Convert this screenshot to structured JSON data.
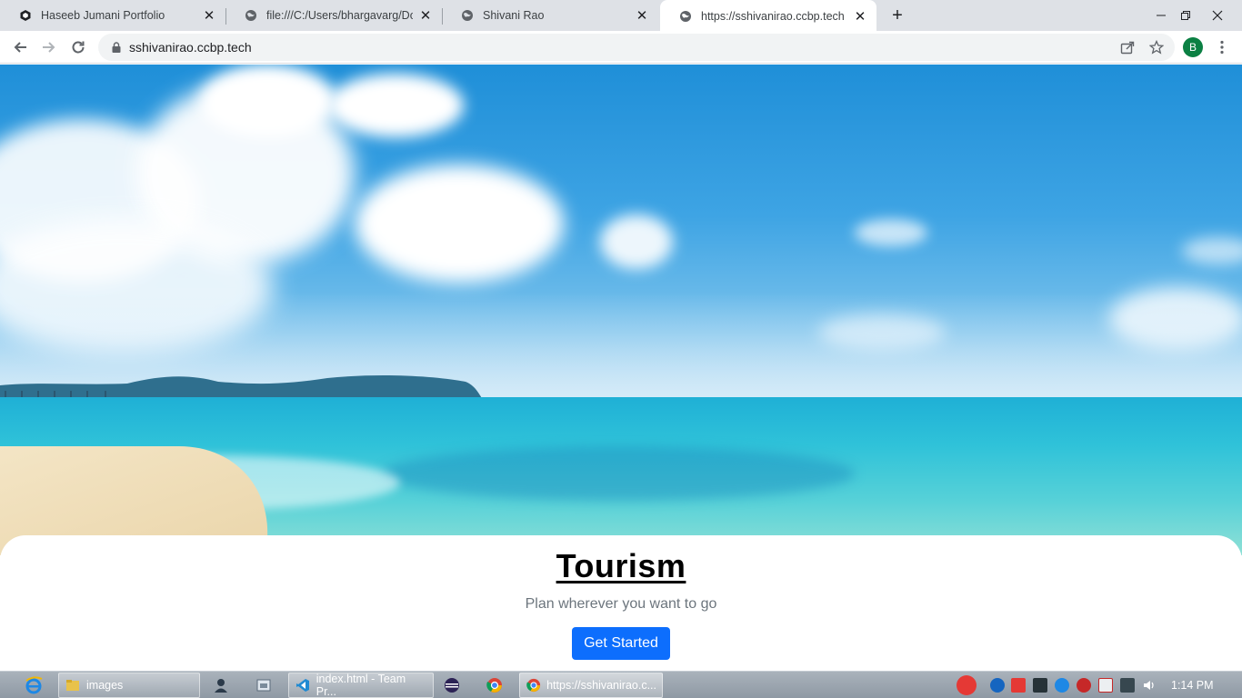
{
  "browser": {
    "tabs": [
      {
        "title": "Haseeb Jumani Portfolio",
        "icon": "webflow-icon",
        "active": false
      },
      {
        "title": "file:///C:/Users/bhargavarg/Down",
        "icon": "globe-icon",
        "active": false
      },
      {
        "title": "Shivani Rao",
        "icon": "globe-icon",
        "active": false
      },
      {
        "title": "https://sshivanirao.ccbp.tech",
        "icon": "globe-icon",
        "active": true
      }
    ],
    "address_bar": {
      "url": "sshivanirao.ccbp.tech"
    },
    "profile_initial": "B"
  },
  "page": {
    "heading": "Tourism",
    "subtitle": "Plan wherever you want to go",
    "cta_label": "Get Started",
    "accent_color": "#0d6efd"
  },
  "taskbar": {
    "items": [
      {
        "label": "images",
        "icon": "folder-icon"
      },
      {
        "label": "index.html - Team Pr...",
        "icon": "vscode-icon"
      },
      {
        "label": "https://sshivanirao.c...",
        "icon": "chrome-icon"
      }
    ],
    "clock": "1:14 PM"
  }
}
